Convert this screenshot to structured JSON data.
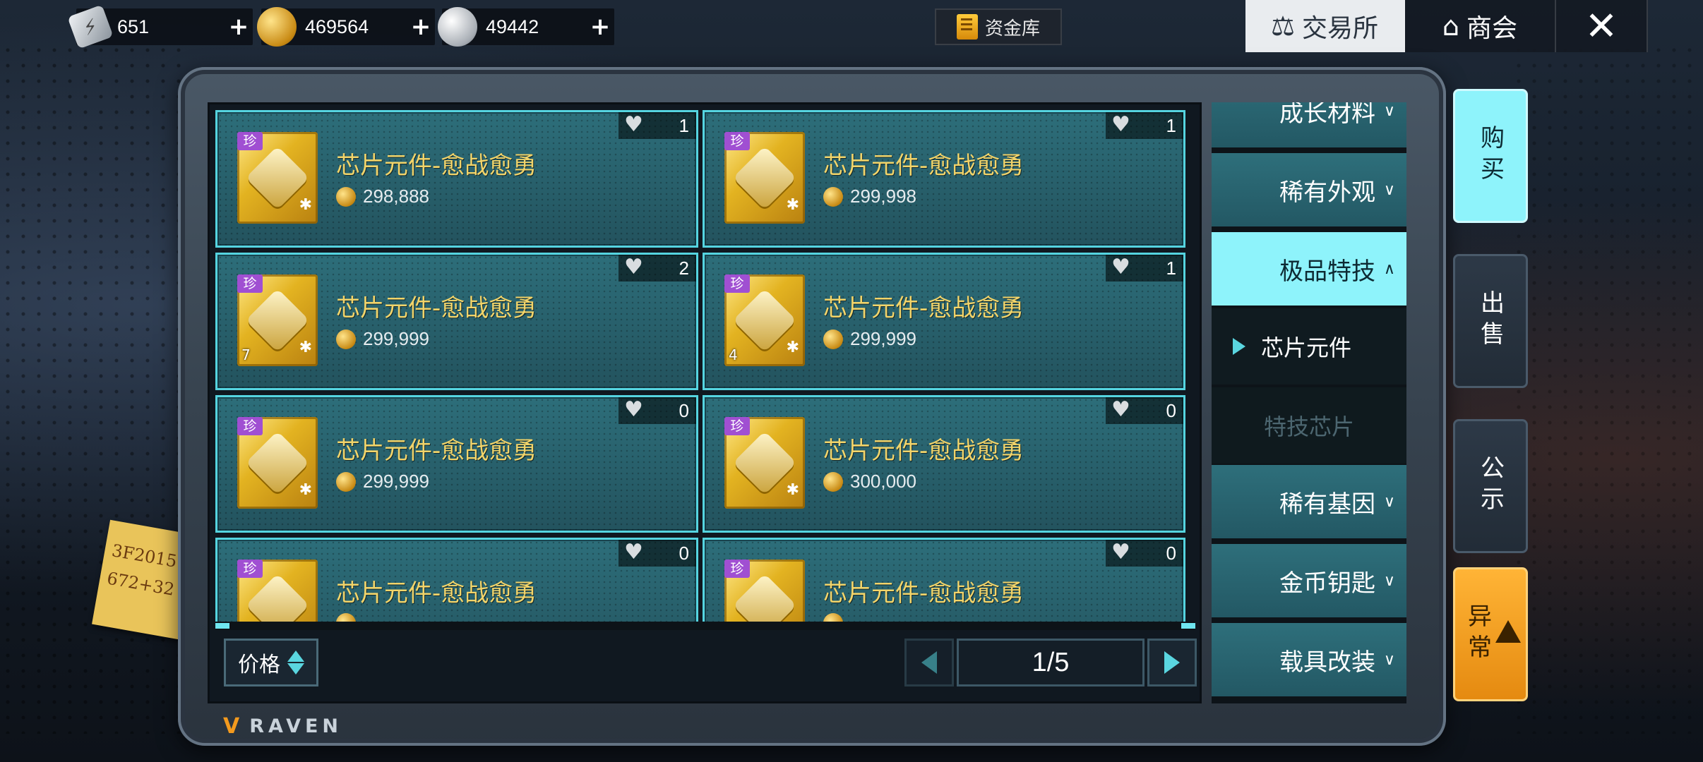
{
  "currencies": [
    {
      "icon": "chip-icon",
      "value": "651",
      "plus": "+"
    },
    {
      "icon": "gold-coin-icon",
      "value": "469564",
      "plus": "+"
    },
    {
      "icon": "silver-coin-icon",
      "value": "49442",
      "plus": "+"
    }
  ],
  "vault": {
    "label": "资金库"
  },
  "top_tabs": {
    "exchange": "交易所",
    "guild": "商会",
    "close": "✕"
  },
  "listings": [
    {
      "rarity": "珍",
      "name": "芯片元件-愈战愈勇",
      "price": "298,888",
      "favorites": "1",
      "qty": ""
    },
    {
      "rarity": "珍",
      "name": "芯片元件-愈战愈勇",
      "price": "299,998",
      "favorites": "1",
      "qty": ""
    },
    {
      "rarity": "珍",
      "name": "芯片元件-愈战愈勇",
      "price": "299,999",
      "favorites": "2",
      "qty": "7"
    },
    {
      "rarity": "珍",
      "name": "芯片元件-愈战愈勇",
      "price": "299,999",
      "favorites": "1",
      "qty": "4"
    },
    {
      "rarity": "珍",
      "name": "芯片元件-愈战愈勇",
      "price": "299,999",
      "favorites": "0",
      "qty": ""
    },
    {
      "rarity": "珍",
      "name": "芯片元件-愈战愈勇",
      "price": "300,000",
      "favorites": "0",
      "qty": ""
    },
    {
      "rarity": "珍",
      "name": "芯片元件-愈战愈勇",
      "price": "",
      "favorites": "0",
      "qty": ""
    },
    {
      "rarity": "珍",
      "name": "芯片元件-愈战愈勇",
      "price": "",
      "favorites": "0",
      "qty": ""
    }
  ],
  "sort": {
    "label": "价格"
  },
  "pagination": {
    "page": "1/5"
  },
  "categories": [
    {
      "label": "成长材料",
      "state": "collapsed"
    },
    {
      "label": "稀有外观",
      "state": "collapsed"
    },
    {
      "label": "极品特技",
      "state": "expanded"
    },
    {
      "label": "芯片元件",
      "state": "selected-sub"
    },
    {
      "label": "特技芯片",
      "state": "disabled-sub"
    },
    {
      "label": "稀有基因",
      "state": "collapsed"
    },
    {
      "label": "金币钥匙",
      "state": "collapsed"
    },
    {
      "label": "载具改装",
      "state": "collapsed"
    }
  ],
  "side_tabs": {
    "buy": "购买",
    "sell": "出售",
    "notice": "公示",
    "abnormal": "异常"
  },
  "brand": "RAVEN",
  "note_text": [
    "3F2015",
    "672+32"
  ],
  "colors": {
    "accent": "#8ef3fb",
    "card_border": "#55d4e0",
    "item_name": "#f2d46a",
    "rare_badge": "#a04fd2",
    "warning": "#ffb436"
  }
}
